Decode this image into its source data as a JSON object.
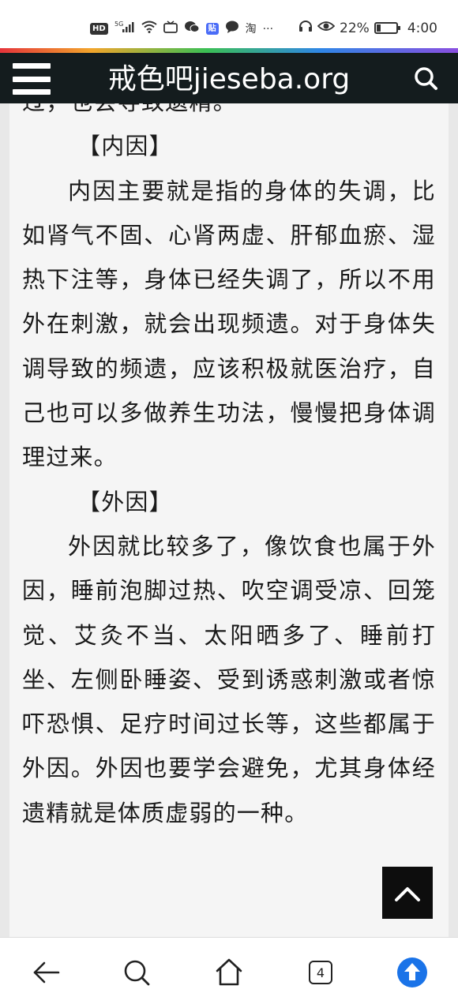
{
  "status_bar": {
    "hd_label": "HD",
    "network_label": "5G",
    "app_label_tieba": "贴",
    "app_label_taobao": "淘",
    "more_label": "···",
    "battery_percent": "22%",
    "battery_level": 0.22,
    "time": "4:00"
  },
  "header": {
    "site_title": "戒色吧jieseba.org"
  },
  "article": {
    "partial_top_line": "过，也会导致遗精。",
    "heading_internal": "【内因】",
    "paragraph_internal": "内因主要就是指的身体的失调，比如肾气不固、心肾两虚、肝郁血瘀、湿热下注等，身体已经失调了，所以不用外在刺激，就会出现频遗。对于身体失调导致的频遗，应该积极就医治疗，自己也可以多做养生功法，慢慢把身体调理过来。",
    "heading_external": "【外因】",
    "paragraph_external": "外因就比较多了，像饮食也属于外因，睡前泡脚过热、吹空调受凉、回笼觉、艾灸不当、太阳晒多了、睡前打坐、左侧卧睡姿、受到诱惑刺激或者惊吓恐惧、足疗时间过长等，这些都属于外因。外因也要学会避免，尤其身体经遗精就是体质虚弱的一种。"
  },
  "bottom_nav": {
    "tab_count": "4"
  },
  "colors": {
    "header_bg": "#141c1e",
    "accent_blue": "#1a73e8",
    "content_bg": "#f5f5f5"
  },
  "icons": [
    "menu-icon",
    "search-icon",
    "back-to-top-icon",
    "back-arrow-icon",
    "search-nav-icon",
    "home-icon",
    "tabs-icon",
    "upload-icon"
  ]
}
